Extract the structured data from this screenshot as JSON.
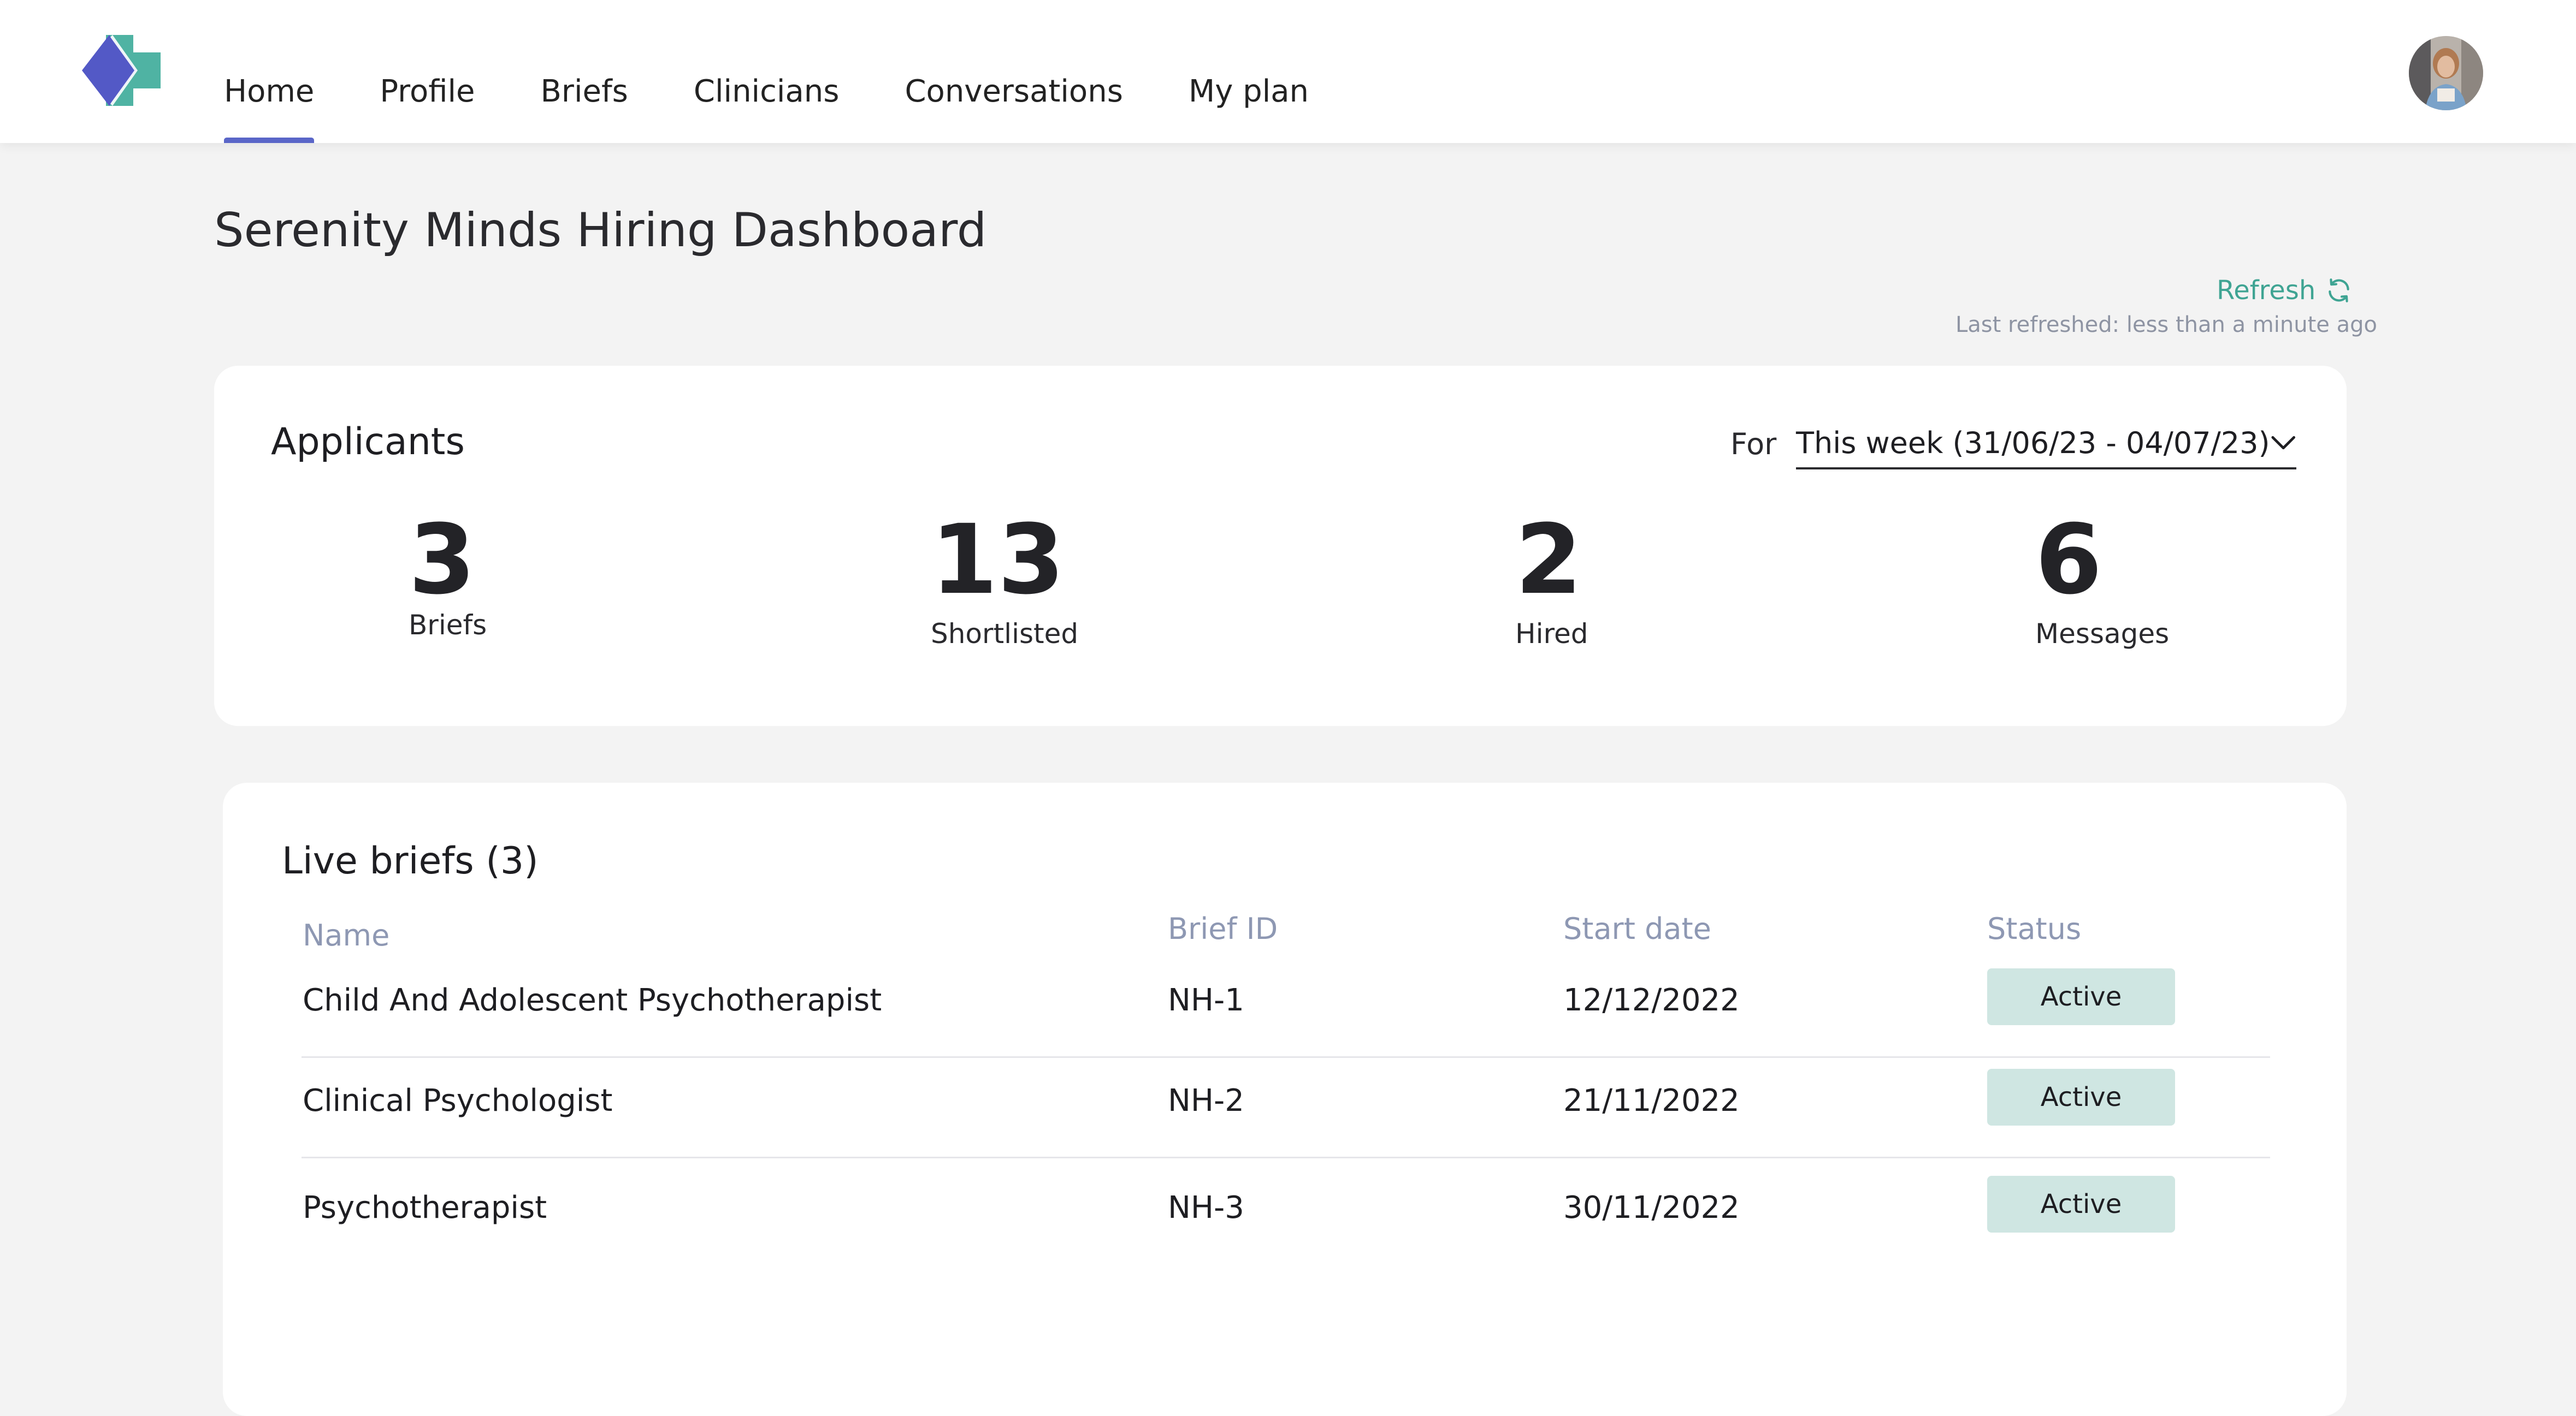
{
  "nav": {
    "tabs": [
      {
        "label": "Home",
        "active": true
      },
      {
        "label": "Profile",
        "active": false
      },
      {
        "label": "Briefs",
        "active": false
      },
      {
        "label": "Clinicians",
        "active": false
      },
      {
        "label": "Conversations",
        "active": false
      },
      {
        "label": "My plan",
        "active": false
      }
    ]
  },
  "page": {
    "title": "Serenity Minds Hiring Dashboard",
    "refresh_label": "Refresh",
    "last_refreshed": "Last refreshed: less than a minute ago"
  },
  "applicants": {
    "title": "Applicants",
    "for_label": "For",
    "period": "This week (31/06/23 -  04/07/23)",
    "stats": [
      {
        "value": "3",
        "label": "Briefs"
      },
      {
        "value": "13",
        "label": "Shortlisted"
      },
      {
        "value": "2",
        "label": "Hired"
      },
      {
        "value": "6",
        "label": "Messages"
      }
    ]
  },
  "briefs": {
    "title": "Live briefs (3)",
    "columns": {
      "name": "Name",
      "brief_id": "Brief ID",
      "start_date": "Start date",
      "status": "Status"
    },
    "rows": [
      {
        "name": "Child And Adolescent Psychotherapist",
        "brief_id": "NH-1",
        "start_date": "12/12/2022",
        "status": "Active"
      },
      {
        "name": "Clinical Psychologist",
        "brief_id": "NH-2",
        "start_date": "21/11/2022",
        "status": "Active"
      },
      {
        "name": "Psychotherapist",
        "brief_id": "NH-3",
        "start_date": "30/11/2022",
        "status": "Active"
      }
    ]
  },
  "colors": {
    "accent": "#5a66c8",
    "brand_teal": "#4fb3a3",
    "brand_blue": "#5359c6",
    "status_active_bg": "#cfe6e2"
  },
  "icons": {
    "logo": "brand-logo-icon",
    "refresh": "refresh-icon",
    "dropdown": "chevron-down-icon",
    "avatar": "user-avatar"
  }
}
